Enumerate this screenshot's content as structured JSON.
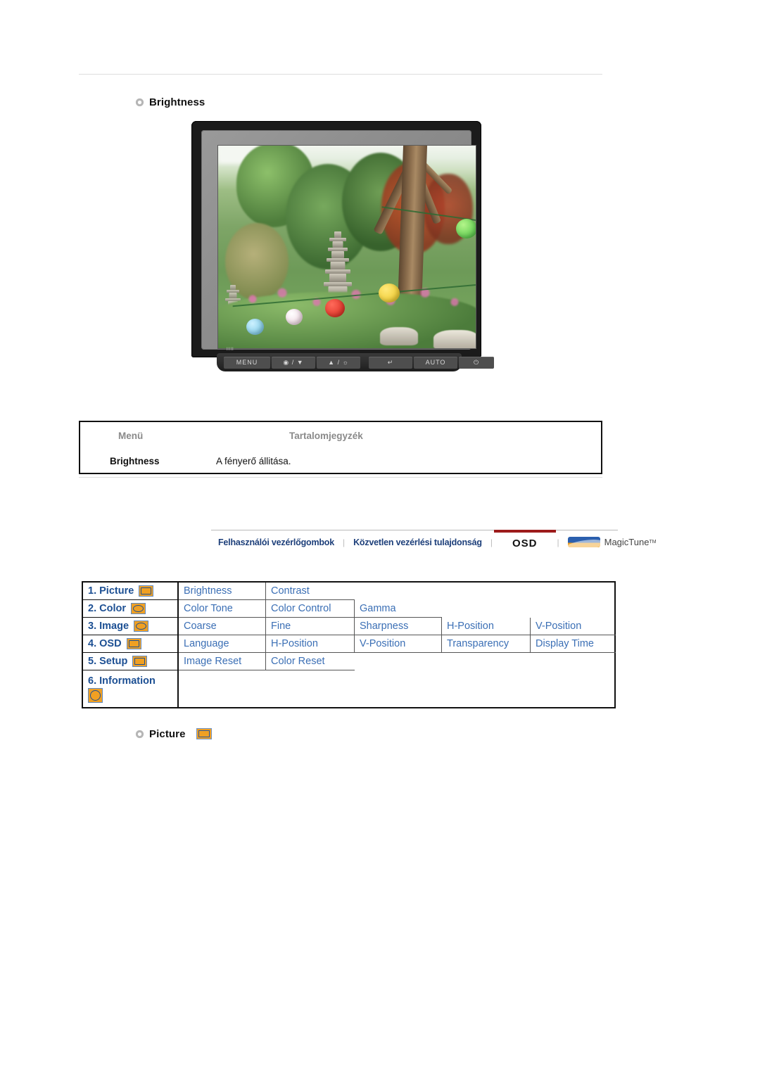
{
  "document": {
    "title": "Samsung monitor OSD manual page",
    "language": "hu"
  },
  "sections": {
    "brightness_heading": "Brightness",
    "picture_heading": "Picture"
  },
  "monitor": {
    "buttons": [
      "MENU",
      "◉ / ▼",
      "▲ / ☼",
      "↵",
      "AUTO",
      "⏻"
    ],
    "menu_label": "MENU",
    "auto_label": "AUTO",
    "logo": "IIII"
  },
  "description_table": {
    "headers": [
      "Menü",
      "Tartalomjegyzék"
    ],
    "rows": [
      {
        "menu": "Brightness",
        "description": "A fényerő állitása."
      }
    ]
  },
  "navbar": {
    "items": [
      {
        "label": "Felhasználói vezérlőgombok",
        "active": false,
        "style": "blue"
      },
      {
        "label": "Közvetlen vezérlési tulajdonság",
        "active": false,
        "style": "blue"
      },
      {
        "label": "OSD",
        "active": true,
        "style": "plain"
      },
      {
        "label": "MagicTune",
        "superscript": "TM",
        "active": false,
        "style": "logo"
      }
    ],
    "separator": "|",
    "active_color": "#9d1b1b"
  },
  "osd_table": {
    "rows": [
      {
        "menu": "1. Picture",
        "icon": "picture-icon",
        "items": [
          "Brightness",
          "Contrast"
        ]
      },
      {
        "menu": "2. Color",
        "icon": "color-icon",
        "items": [
          "Color Tone",
          "Color Control",
          "Gamma"
        ]
      },
      {
        "menu": "3. Image",
        "icon": "image-icon",
        "items": [
          "Coarse",
          "Fine",
          "Sharpness",
          "H-Position",
          "V-Position"
        ]
      },
      {
        "menu": "4. OSD",
        "icon": "osd-icon",
        "items": [
          "Language",
          "H-Position",
          "V-Position",
          "Transparency",
          "Display Time"
        ]
      },
      {
        "menu": "5. Setup",
        "icon": "setup-icon",
        "items": [
          "Image Reset",
          "Color Reset"
        ]
      },
      {
        "menu": "6. Information",
        "icon": "information-icon",
        "items": []
      }
    ],
    "text_color": "#3b6fb5",
    "menu_color": "#1c4f93",
    "icon_fill": "#f0a023",
    "icon_border": "#5f8ac4"
  }
}
